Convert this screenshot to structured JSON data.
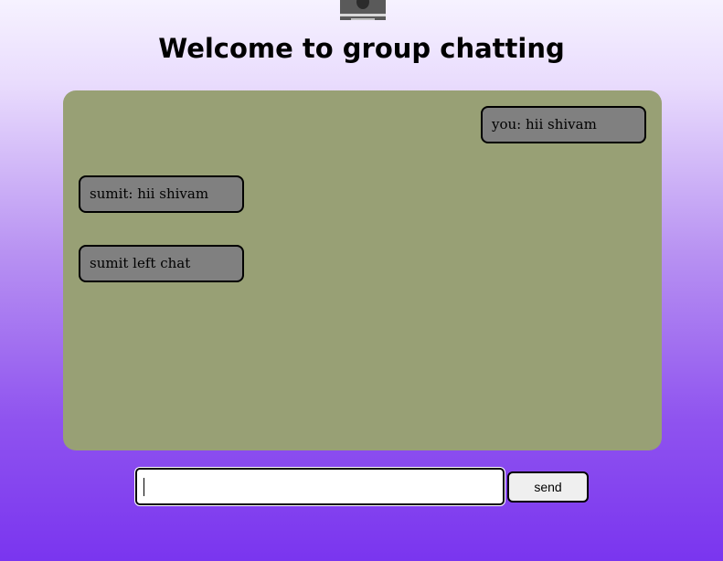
{
  "header": {
    "title": "Welcome to group chatting"
  },
  "chat": {
    "messages": [
      {
        "side": "right",
        "text": "you: hii shivam"
      },
      {
        "side": "left",
        "text": "sumit: hii shivam"
      },
      {
        "side": "left",
        "text": "sumit left chat"
      }
    ]
  },
  "composer": {
    "value": "",
    "placeholder": "",
    "send_label": "send"
  },
  "colors": {
    "chat_background": "#98a075",
    "message_background": "#808080",
    "gradient_top": "#f6f2ff",
    "gradient_bottom": "#7a35ef"
  },
  "icons": {
    "logo": "user-photo-logo"
  }
}
